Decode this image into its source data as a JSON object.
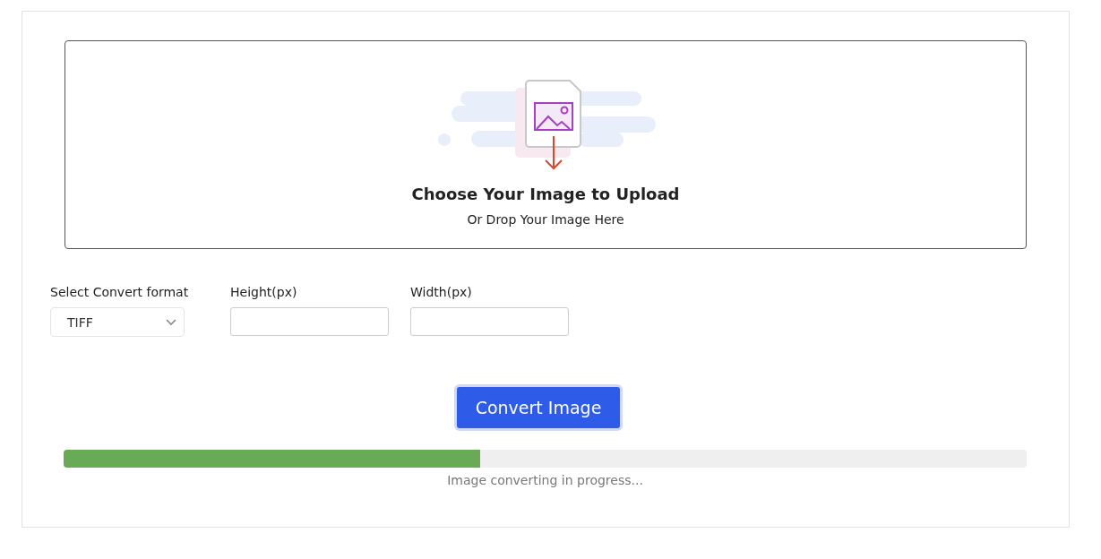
{
  "upload": {
    "title": "Choose Your Image to Upload",
    "subtitle": "Or Drop Your Image Here"
  },
  "fields": [
    {
      "kind": "select",
      "label": "Select Convert format",
      "value": "TIFF"
    },
    {
      "kind": "input",
      "label": "Height(px)"
    },
    {
      "kind": "input",
      "label": "Width(px)"
    }
  ],
  "button": {
    "label": "Convert Image"
  },
  "progress": {
    "level": 0.433,
    "status": "Image converting in progress..."
  }
}
